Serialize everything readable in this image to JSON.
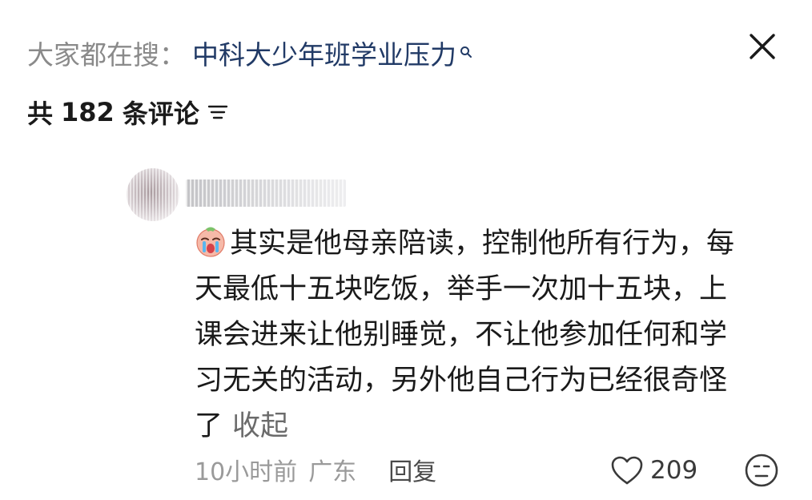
{
  "search": {
    "prefix": "大家都在搜：",
    "term": "中科大少年班学业压力",
    "search_icon": "search-icon"
  },
  "header": {
    "close_icon": "close-icon"
  },
  "comments_header": {
    "prefix": "共",
    "count": "182",
    "suffix": "条评论",
    "sort_icon": "sort-filter-icon"
  },
  "comment": {
    "emoji": "crying-face-emoji-icon",
    "text_lines": [
      "其实是他母亲陪读，控制他所有行为，每",
      "天最低十五块吃饭，举手一次加十五块，上",
      "课会进来让他别睡觉，不让他参加任何和学",
      "习无关的活动，另外他自己行为已经很奇怪",
      "了"
    ],
    "collapse_label": "收起",
    "time": "10小时前",
    "region": "广东",
    "reply_label": "回复",
    "like_count": "209",
    "like_icon": "heart-outline-icon",
    "dislike_icon": "unhappy-face-icon"
  },
  "colors": {
    "search_term": "#213a66",
    "muted_text": "#8a8a8a",
    "body_text": "#1a1a1a"
  }
}
